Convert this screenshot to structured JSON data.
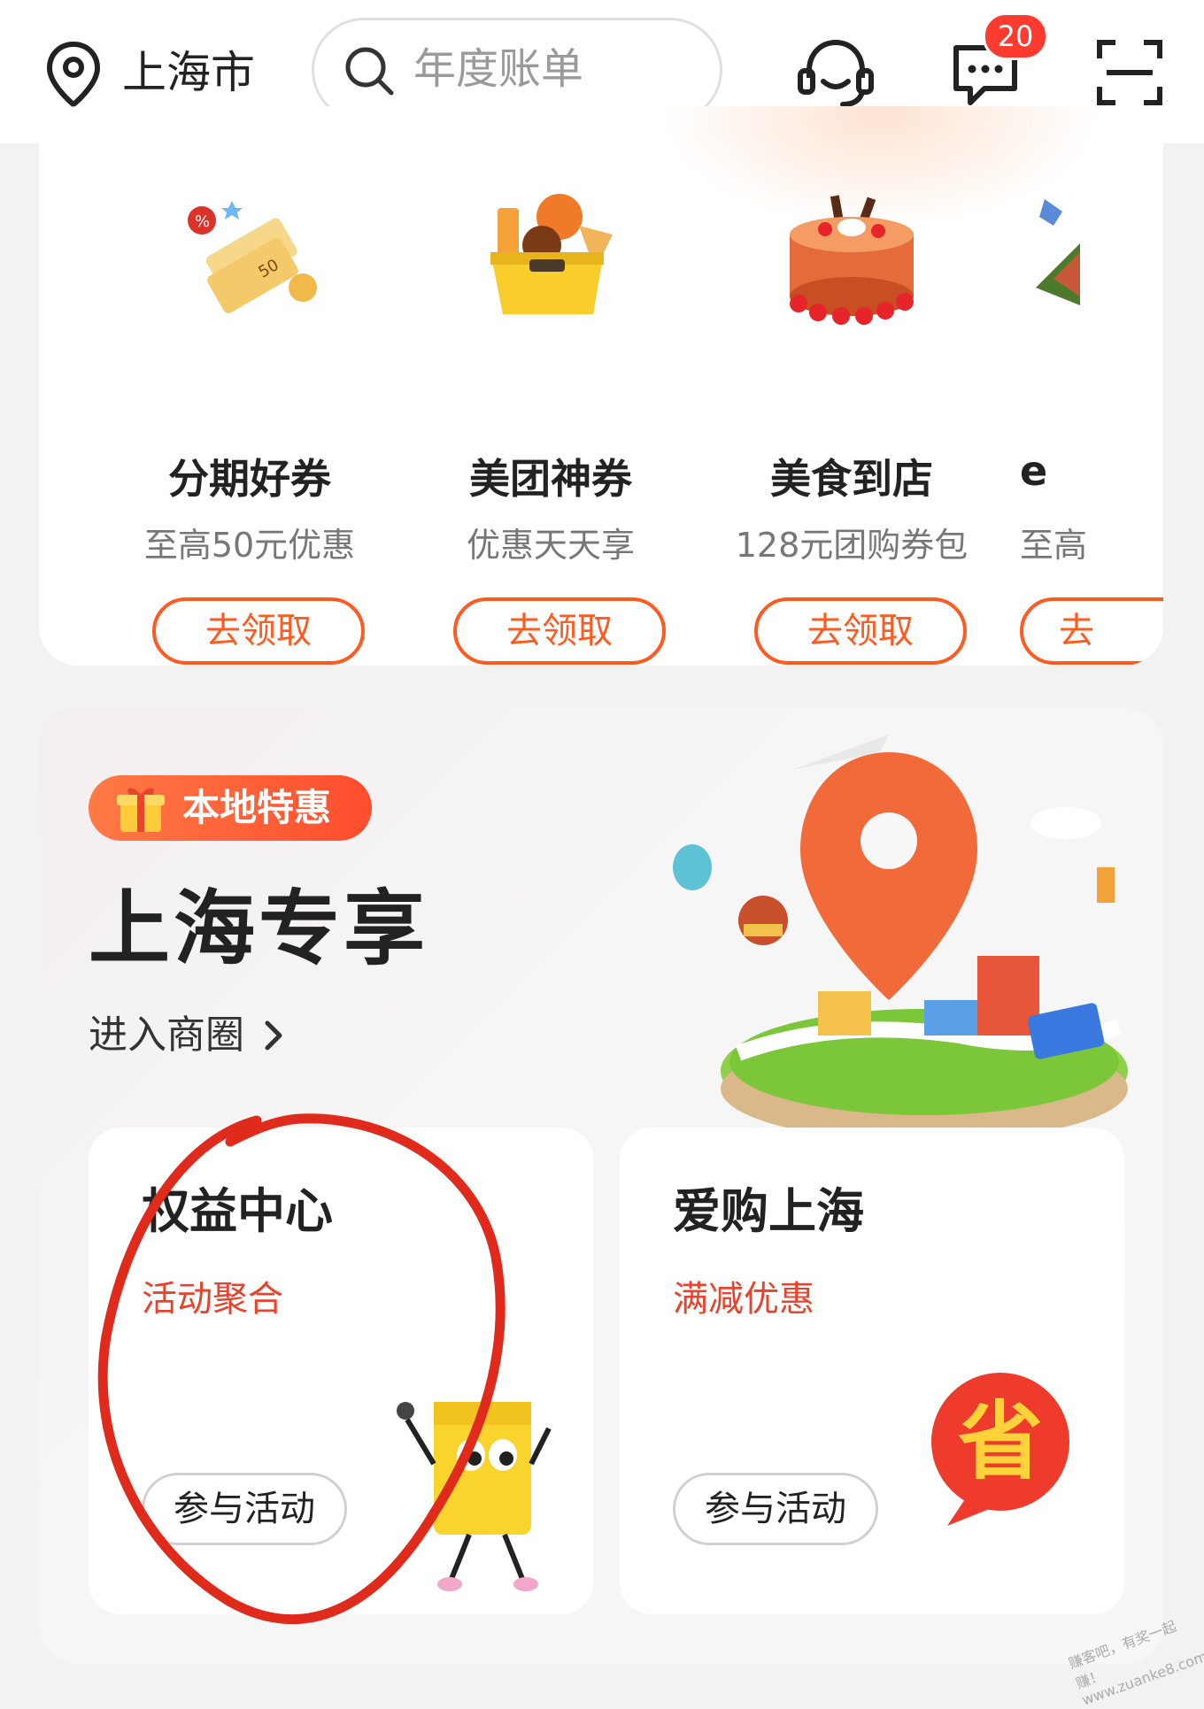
{
  "header": {
    "city": "上海市",
    "search_placeholder": "年度账单",
    "message_badge": "20",
    "icons": [
      "location-pin-icon",
      "search-icon",
      "customer-service-icon",
      "message-icon",
      "scan-icon"
    ]
  },
  "coupons": {
    "items": [
      {
        "title": "分期好券",
        "subtitle": "至高50元优惠",
        "button": "去领取",
        "icon": "coupon-tickets-icon"
      },
      {
        "title": "美团神券",
        "subtitle": "优惠天天享",
        "button": "去领取",
        "icon": "delivery-box-icon"
      },
      {
        "title": "美食到店",
        "subtitle": "128元团购券包",
        "button": "去领取",
        "icon": "cake-icon"
      },
      {
        "title": "e",
        "subtitle": "至高",
        "button": "去",
        "icon": "partial-item-icon"
      }
    ],
    "ticket_text": "50"
  },
  "local": {
    "badge": "本地特惠",
    "title": "上海专享",
    "link": "进入商圈",
    "cards": [
      {
        "title": "权益中心",
        "subtitle": "活动聚合",
        "button": "参与活动"
      },
      {
        "title": "爱购上海",
        "subtitle": "满减优惠",
        "button": "参与活动",
        "icon_char": "省"
      }
    ]
  },
  "colors": {
    "accent": "#ff5a1f",
    "subtitle_red": "#e8432c",
    "badge_red": "#ff3b30",
    "annotation_red": "#e02a1c"
  },
  "watermark": "赚客吧，有奖一起赚！www.zuanke8.com"
}
